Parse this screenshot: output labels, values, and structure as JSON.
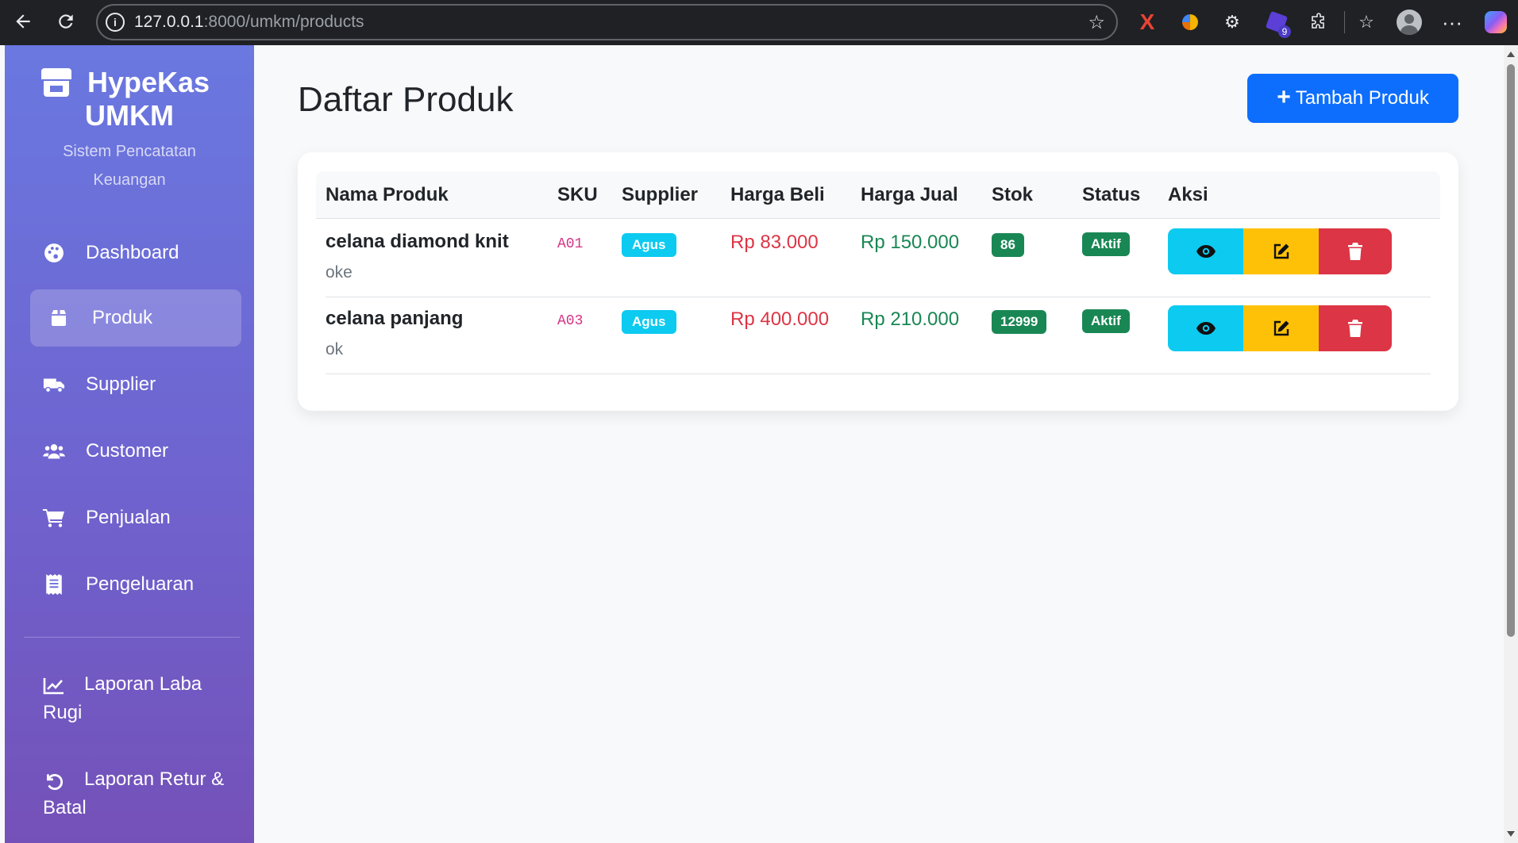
{
  "browser": {
    "url_host": "127.0.0.1",
    "url_rest": ":8000/umkm/products",
    "extension_badge": "9"
  },
  "sidebar": {
    "brand_line1": "HypeKas",
    "brand_line2": "UMKM",
    "subtitle": "Sistem Pencatatan Keuangan",
    "items": [
      {
        "label": "Dashboard",
        "icon": "palette-icon"
      },
      {
        "label": "Produk",
        "icon": "box-icon"
      },
      {
        "label": "Supplier",
        "icon": "truck-icon"
      },
      {
        "label": "Customer",
        "icon": "users-icon"
      },
      {
        "label": "Penjualan",
        "icon": "cart-icon"
      },
      {
        "label": "Pengeluaran",
        "icon": "receipt-icon"
      },
      {
        "label": "Laporan Laba Rugi",
        "icon": "chart-line-icon"
      },
      {
        "label": "Laporan Retur & Batal",
        "icon": "undo-icon"
      }
    ],
    "active": "Produk"
  },
  "main": {
    "title": "Daftar Produk",
    "add_button": "Tambah Produk",
    "table": {
      "headers": [
        "Nama Produk",
        "SKU",
        "Supplier",
        "Harga Beli",
        "Harga Jual",
        "Stok",
        "Status",
        "Aksi"
      ],
      "rows": [
        {
          "name": "celana diamond knit",
          "desc": "oke",
          "sku": "A01",
          "supplier": "Agus",
          "buy": "Rp 83.000",
          "sell": "Rp 150.000",
          "stock": "86",
          "status": "Aktif"
        },
        {
          "name": "celana panjang",
          "desc": "ok",
          "sku": "A03",
          "supplier": "Agus",
          "buy": "Rp 400.000",
          "sell": "Rp 210.000",
          "stock": "12999",
          "status": "Aktif"
        }
      ]
    }
  },
  "colors": {
    "primary": "#0d6efd",
    "info": "#0dcaf0",
    "warning": "#ffc107",
    "danger": "#dc3545",
    "success": "#198754",
    "sidebar_top": "#6a78e0",
    "sidebar_bottom": "#7451b8"
  }
}
